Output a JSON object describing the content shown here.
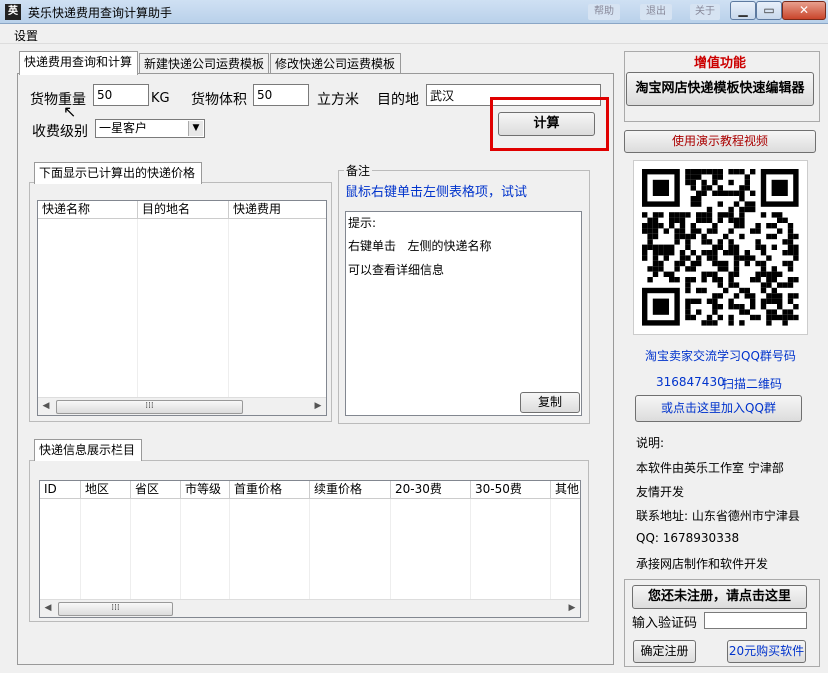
{
  "window": {
    "title": "英乐快递费用查询计算助手",
    "icon_text": "英"
  },
  "titlebar_blurred": [
    "帮助",
    "退出",
    "关于"
  ],
  "menu": {
    "settings": "设置"
  },
  "tabs": [
    "快递费用查询和计算",
    "新建快递公司运费模板",
    "修改快递公司运费模板"
  ],
  "form": {
    "weight_label": "货物重量",
    "weight_value": "50",
    "weight_unit": "KG",
    "volume_label": "货物体积",
    "volume_value": "50",
    "volume_unit": "立方米",
    "dest_label": "目的地",
    "dest_value": "武汉",
    "level_label": "收费级别",
    "level_value": "一星客户",
    "calc_button": "计算"
  },
  "price_group": {
    "title": "下面显示已计算出的快递价格",
    "columns": [
      "快递名称",
      "目的地名",
      "快递费用"
    ]
  },
  "remark": {
    "title": "备注",
    "hint": "鼠标右键单击左侧表格项，试试",
    "lines": [
      "提示:",
      "右键单击   左侧的快递名称",
      "可以查看详细信息"
    ],
    "copy_button": "复制"
  },
  "info_group": {
    "title": "快递信息展示栏目",
    "columns": [
      "ID",
      "地区",
      "省区",
      "市等级",
      "首重价格",
      "续重价格",
      "20-30费",
      "30-50费",
      "其他"
    ]
  },
  "sidebar": {
    "value_added_title": "增值功能",
    "editor_button": "淘宝网店快递模板快速编辑器",
    "tutorial_button": "使用演示教程视频",
    "qq_group_label": "淘宝卖家交流学习QQ群号码",
    "qq_group_number": "316847430",
    "scan_label": "扫描二维码",
    "join_button": "或点击这里加入QQ群",
    "notes": [
      "说明:",
      "本软件由英乐工作室 宁津部",
      "友情开发",
      "联系地址: 山东省德州市宁津县",
      "QQ: 1678930338",
      "承接网店制作和软件开发"
    ],
    "register_button": "您还未注册，请点击这里",
    "code_label": "输入验证码",
    "confirm_button": "确定注册",
    "buy_button": "20元购买软件"
  },
  "colors": {
    "highlight_red": "#e00000",
    "title_red": "#cc0000",
    "link_blue": "#0033cc",
    "tutorial_text": "#aa0000"
  }
}
